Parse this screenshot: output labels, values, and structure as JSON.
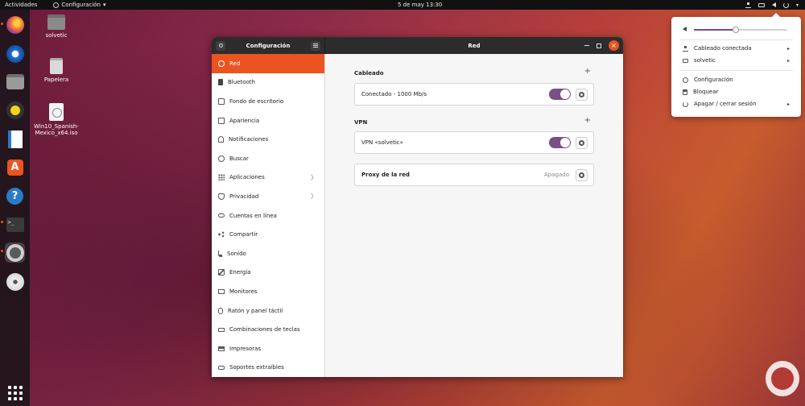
{
  "topbar": {
    "activities": "Actividades",
    "app_menu": "Configuración",
    "app_menu_arrow": "▾",
    "clock": "5 de may  13:30",
    "tray_arrow": "▾"
  },
  "dock": {
    "items": [
      "firefox-icon",
      "thunderbird-icon",
      "files-icon",
      "rhythmbox-icon",
      "writer-icon",
      "software-icon",
      "help-icon",
      "terminal-icon",
      "settings-icon",
      "dvd-icon",
      "show-apps-icon"
    ],
    "store_glyph": "A",
    "help_glyph": "?",
    "terminal_glyph": ">_"
  },
  "desktop": {
    "icons": [
      {
        "label": "solvetic"
      },
      {
        "label": "Papelera"
      },
      {
        "label": "Win10_Spanish-Mexico_x64.iso"
      }
    ]
  },
  "window": {
    "sidebar_title": "Configuración",
    "panel_title": "Red",
    "close_glyph": "×",
    "sidebar": [
      {
        "label": "Red",
        "icon": "network-icon",
        "selected": true
      },
      {
        "label": "Bluetooth",
        "icon": "bluetooth-icon"
      },
      {
        "label": "Fondo de escritorio",
        "icon": "background-icon"
      },
      {
        "label": "Apariencia",
        "icon": "appearance-icon"
      },
      {
        "label": "Notificaciones",
        "icon": "notifications-icon"
      },
      {
        "label": "Buscar",
        "icon": "search-icon"
      },
      {
        "label": "Aplicaciones",
        "icon": "applications-icon",
        "chevron": "〉"
      },
      {
        "label": "Privacidad",
        "icon": "privacy-icon",
        "chevron": "〉"
      },
      {
        "label": "Cuentas en línea",
        "icon": "online-accounts-icon"
      },
      {
        "label": "Compartir",
        "icon": "sharing-icon"
      },
      {
        "label": "Sonido",
        "icon": "sound-icon"
      },
      {
        "label": "Energía",
        "icon": "power-icon"
      },
      {
        "label": "Monitores",
        "icon": "displays-icon"
      },
      {
        "label": "Ratón y panel táctil",
        "icon": "mouse-icon"
      },
      {
        "label": "Combinaciones de teclas",
        "icon": "keyboard-icon"
      },
      {
        "label": "Impresoras",
        "icon": "printer-icon"
      },
      {
        "label": "Soportes extraíbles",
        "icon": "removable-media-icon"
      }
    ],
    "content": {
      "wired": {
        "title": "Cableado",
        "add": "+",
        "connection": "Conectado - 1000 Mb/s",
        "enabled": true
      },
      "vpn": {
        "title": "VPN",
        "add": "+",
        "connection": "VPN «solvetic»",
        "enabled": true
      },
      "proxy": {
        "label": "Proxy de la red",
        "status": "Apagado"
      }
    }
  },
  "system_menu": {
    "volume_level": 0.45,
    "items": [
      {
        "label": "Cableado conectada",
        "arrow": "▸"
      },
      {
        "label": "solvetic",
        "arrow": "▸"
      },
      {
        "label": "Configuración"
      },
      {
        "label": "Bloquear"
      },
      {
        "label": "Apagar / cerrar sesión",
        "arrow": "▸"
      }
    ]
  },
  "colors": {
    "accent": "#e95420",
    "toggle_on": "#7a4e87",
    "topbar_bg": "#111111",
    "header_bg": "#2c2c2c"
  }
}
